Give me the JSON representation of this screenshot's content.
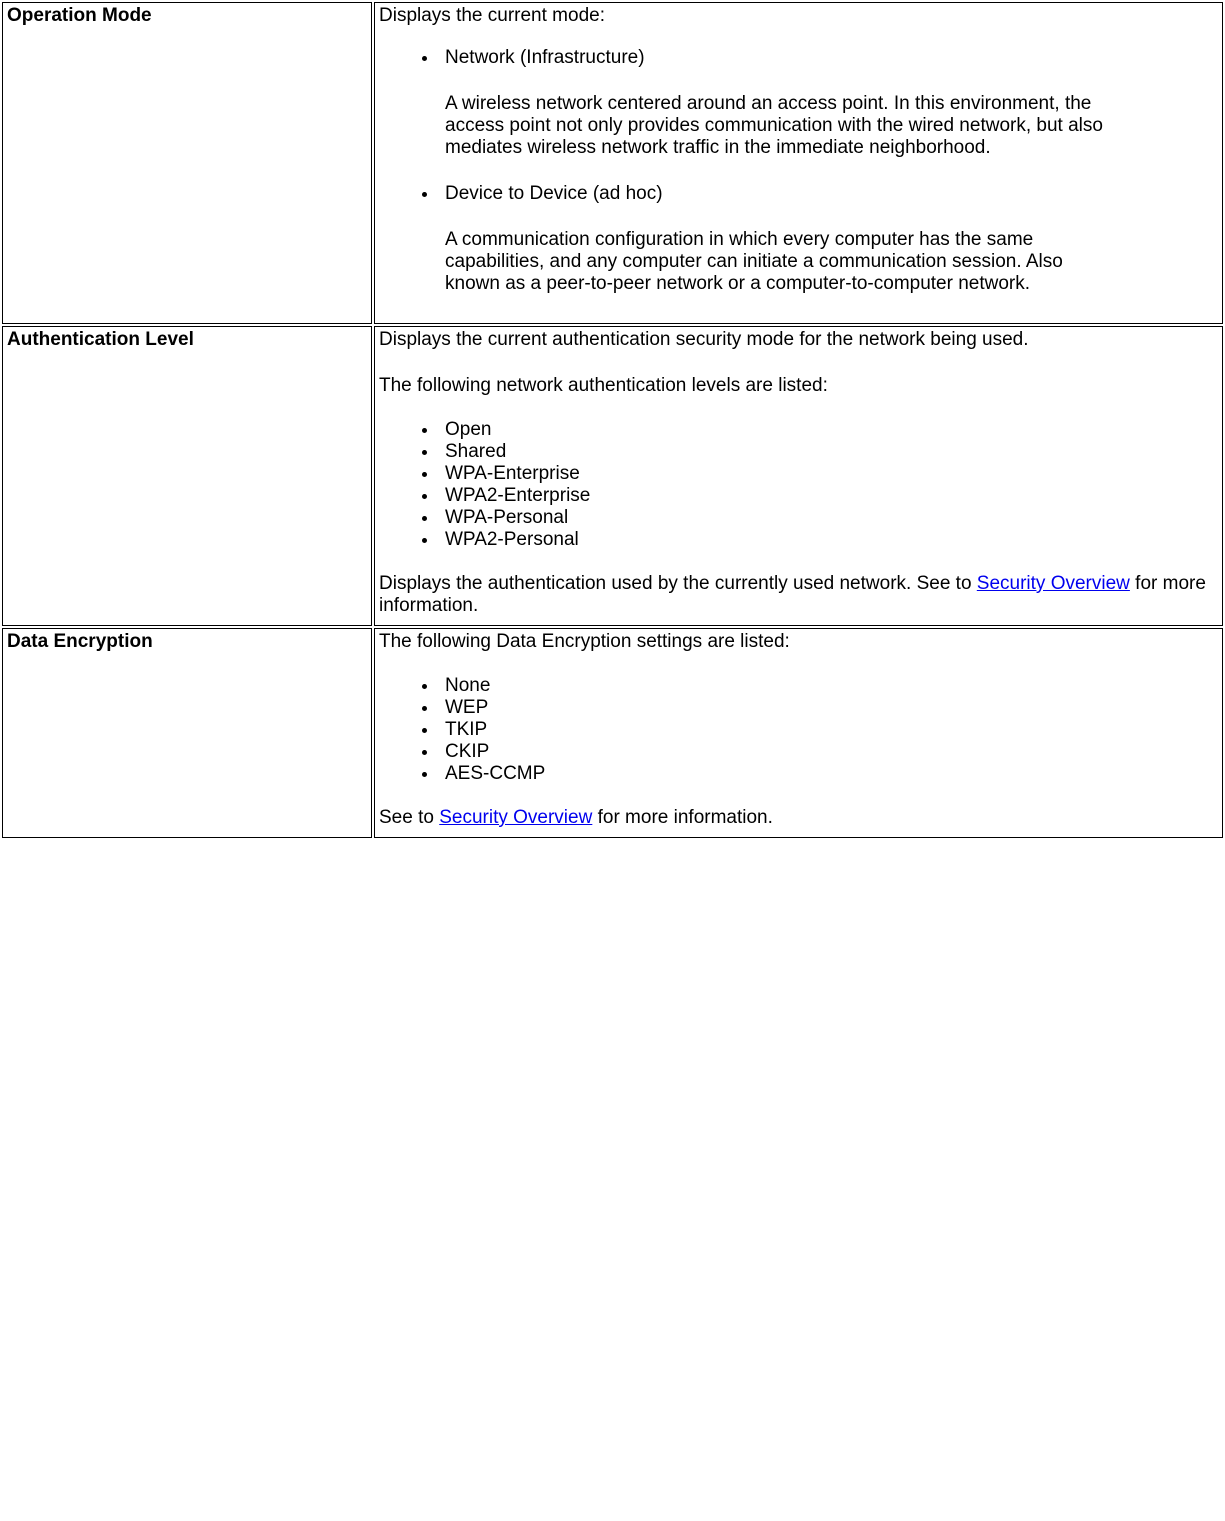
{
  "rows": {
    "op_mode": {
      "label": "Operation Mode",
      "intro": "Displays the current mode:",
      "items": [
        {
          "title": "Network (Infrastructure)",
          "desc": "A wireless network centered around an access point. In this environment, the access point not only provides communication with the wired network, but also mediates wireless network traffic in the immediate neighborhood."
        },
        {
          "title": "Device to Device (ad hoc)",
          "desc": "A communication configuration in which every computer has the same capabilities, and any computer can initiate a communication session. Also known as a peer-to-peer network or a computer-to-computer network."
        }
      ]
    },
    "auth_level": {
      "label": "Authentication Level",
      "intro1": "Displays the current authentication security mode for the network being used.",
      "intro2": "The following network authentication levels are listed:",
      "levels": [
        "Open",
        "Shared",
        "WPA-Enterprise",
        "WPA2-Enterprise",
        "WPA-Personal",
        "WPA2-Personal"
      ],
      "outro_pre": "Displays the authentication used by the currently used network. See to ",
      "outro_link": "Security Overview",
      "outro_post": " for more information."
    },
    "data_enc": {
      "label": "Data Encryption",
      "intro": "The following Data Encryption settings are listed:",
      "settings": [
        "None",
        "WEP",
        "TKIP",
        "CKIP",
        "AES-CCMP"
      ],
      "outro_pre": "See to ",
      "outro_link": "Security Overview",
      "outro_post": " for more information."
    }
  }
}
